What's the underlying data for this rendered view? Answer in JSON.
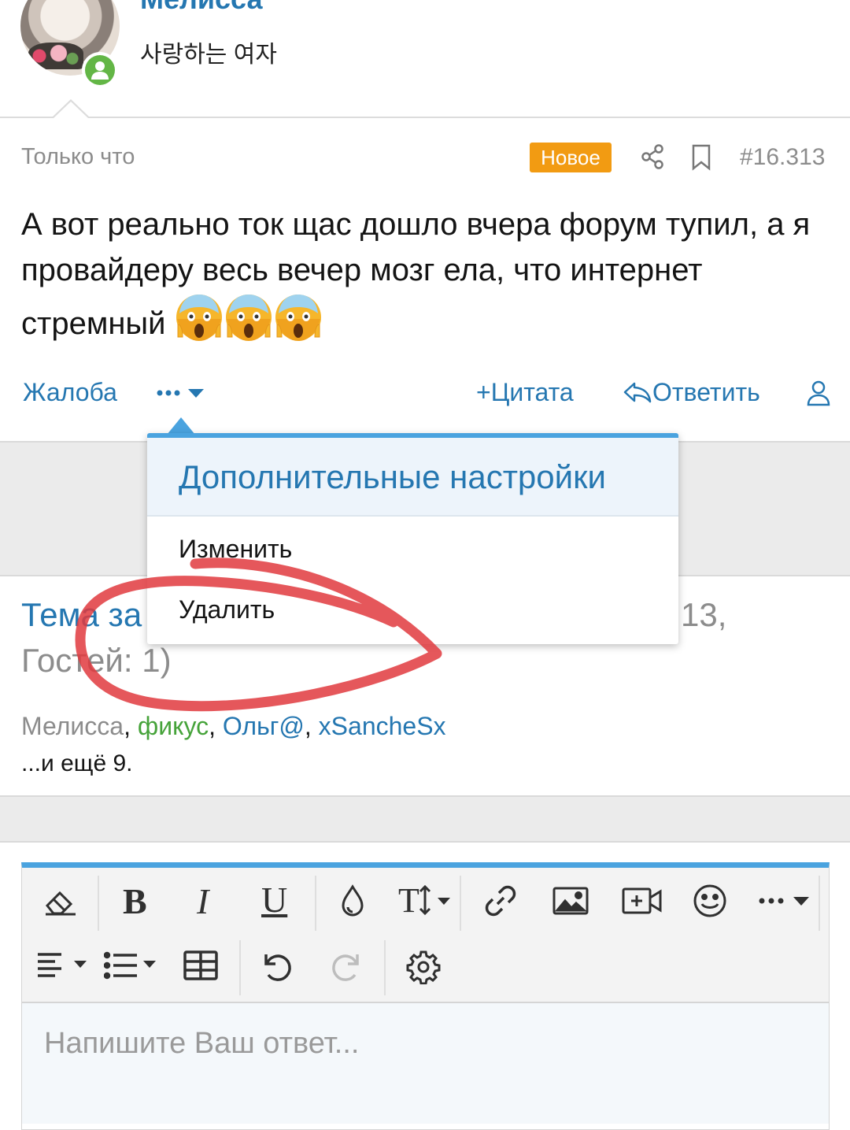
{
  "header": {
    "username": "Мелисса",
    "user_title": "사랑하는 여자"
  },
  "post": {
    "time": "Только что",
    "badge": "Новое",
    "number": "#16.313",
    "message": "А вот реально ток щас дошло вчера форум тупил, а я провайдеру весь вечер мозг ела, что интернет стремный",
    "emoji": "screaming-face-emoji"
  },
  "actions": {
    "report": "Жалоба",
    "quote": "Цитата",
    "reply": "Ответить"
  },
  "menu": {
    "title": "Дополнительные настройки",
    "items": [
      "Изменить",
      "Удалить"
    ]
  },
  "reading": {
    "title_part": "Тема за",
    "count_part": "13,",
    "guests": "Гостей: 1)",
    "users": [
      "Мелисса",
      "фикус",
      "Ольг@",
      "xSancheSx"
    ],
    "separator": ",",
    "more": "...и ещё 9."
  },
  "editor": {
    "placeholder": "Напишите Ваш ответ...",
    "accent_color": "#4aa3df"
  },
  "colors": {
    "link": "#2577b1",
    "badge": "#f29b12",
    "online": "#63b646",
    "annotation": "#e0393e"
  }
}
